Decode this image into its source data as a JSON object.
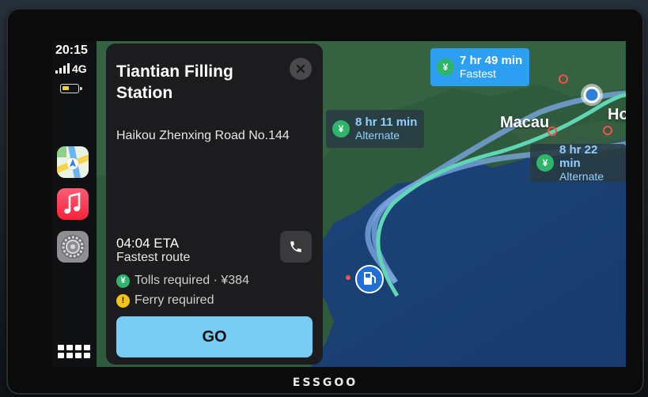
{
  "device": {
    "brand": "ESSGOO"
  },
  "status_bar": {
    "time": "20:15",
    "network": "4G",
    "battery_level": 0.45
  },
  "dock": {
    "apps": [
      {
        "name": "Maps",
        "icon": "maps-icon"
      },
      {
        "name": "Music",
        "icon": "music-icon"
      },
      {
        "name": "Settings",
        "icon": "settings-icon"
      }
    ],
    "app_grid_icon": "app-grid-icon"
  },
  "card": {
    "title": "Tiantian Filling Station",
    "address": "Haikou Zhenxing Road No.144",
    "eta": "04:04 ETA",
    "route_type": "Fastest route",
    "tolls": "Tolls required · ¥384",
    "ferry": "Ferry required",
    "go_label": "GO"
  },
  "map": {
    "routes": [
      {
        "time": "7 hr 49 min",
        "label": "Fastest",
        "coin": "¥"
      },
      {
        "time": "8 hr 11 min",
        "label": "Alternate",
        "coin": "¥"
      },
      {
        "time": "8 hr 22 min",
        "label": "Alternate",
        "coin": "¥"
      }
    ],
    "cities": [
      "Macau",
      "Ho"
    ],
    "zoom_button": "+"
  },
  "colors": {
    "accent": "#79cdf4",
    "fastest_bubble": "#2d9ff2",
    "route_line": "#5fd7b5",
    "toll_icon": "#2eb56a",
    "ferry_icon": "#f3c316",
    "sea": "#1e3f75",
    "land": "#2f5a3d"
  }
}
